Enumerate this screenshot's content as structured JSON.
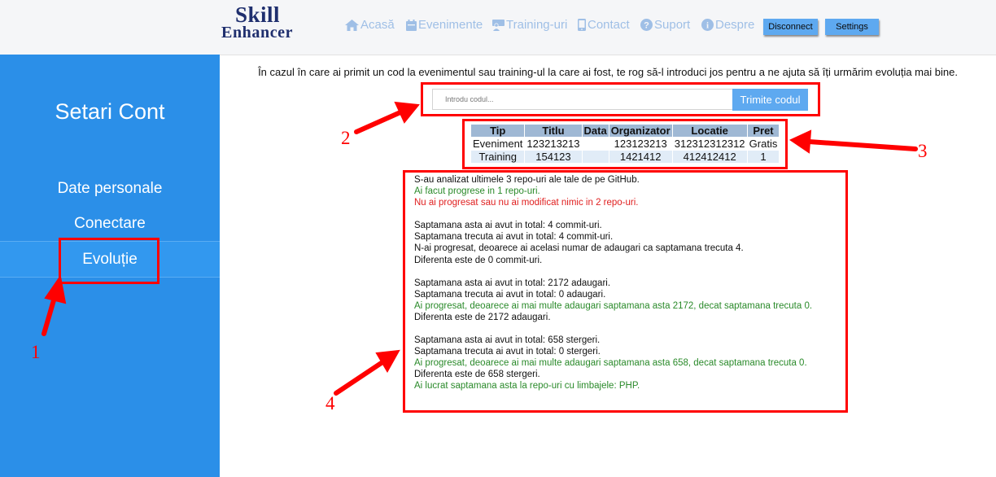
{
  "header": {
    "logo_line1": "Skill",
    "logo_line2": "Enhancer",
    "nav": [
      {
        "icon": "home-icon",
        "label": "Acasă"
      },
      {
        "icon": "calendar-icon",
        "label": "Evenimente"
      },
      {
        "icon": "trainer-icon",
        "label": "Training-uri"
      },
      {
        "icon": "phone-icon",
        "label": "Contact"
      },
      {
        "icon": "question-circle-icon",
        "label": "Suport"
      },
      {
        "icon": "info-circle-icon",
        "label": "Despre"
      }
    ],
    "disconnect_label": "Disconnect",
    "settings_label": "Settings"
  },
  "sidebar": {
    "title": "Setari Cont",
    "items": [
      {
        "label": "Date personale"
      },
      {
        "label": "Conectare"
      },
      {
        "label": "Evoluție"
      }
    ]
  },
  "main": {
    "intro": "În cazul în care ai primit un cod la evenimentul sau training-ul la care ai fost, te rog să-l introduci jos pentru a ne ajuta să îți urmărim evoluția mai bine.",
    "code_placeholder": "Introdu codul...",
    "submit_label": "Trimite codul",
    "table": {
      "headers": [
        "Tip",
        "Titlu",
        "Data",
        "Organizator",
        "Locatie",
        "Pret"
      ],
      "rows": [
        [
          "Eveniment",
          "123213213",
          "",
          "123123213",
          "312312312312",
          "Gratis"
        ],
        [
          "Training",
          "154123",
          "",
          "1421412",
          "412412412",
          "1"
        ]
      ]
    },
    "report": {
      "l1": "S-au analizat ultimele 3 repo-uri ale tale de pe GitHub.",
      "l2": "Ai facut progrese in 1 repo-uri.",
      "l3": "Nu ai progresat sau nu ai modificat nimic in 2 repo-uri.",
      "l4": "Saptamana asta ai avut in total: 4 commit-uri.",
      "l5": "Saptamana trecuta ai avut in total: 4 commit-uri.",
      "l6": "N-ai progresat, deoarece ai acelasi numar de adaugari ca saptamana trecuta 4.",
      "l7": "Diferenta este de 0 commit-uri.",
      "l8": "Saptamana asta ai avut in total: 2172 adaugari.",
      "l9": "Saptamana trecuta ai avut in total: 0 adaugari.",
      "l10": "Ai progresat, deoarece ai mai multe adaugari saptamana asta 2172, decat saptamana trecuta 0.",
      "l11": "Diferenta este de 2172 adaugari.",
      "l12": "Saptamana asta ai avut in total: 658 stergeri.",
      "l13": "Saptamana trecuta ai avut in total: 0 stergeri.",
      "l14": "Ai progresat, deoarece ai mai multe adaugari saptamana asta 658, decat saptamana trecuta 0.",
      "l15": "Diferenta este de 658 stergeri.",
      "l16": "Ai lucrat saptamana asta la repo-uri cu limbajele: PHP."
    }
  },
  "annotations": {
    "n1": "1",
    "n2": "2",
    "n3": "3",
    "n4": "4"
  },
  "colors": {
    "sidebar": "#2b8fe8",
    "button": "#5ea9f0",
    "nav_text": "#9fbfe6",
    "logo": "#1f2f6e",
    "progress_text": "#2a8a2a",
    "no_progress_text": "#e02020",
    "annotation": "#ff0000"
  }
}
